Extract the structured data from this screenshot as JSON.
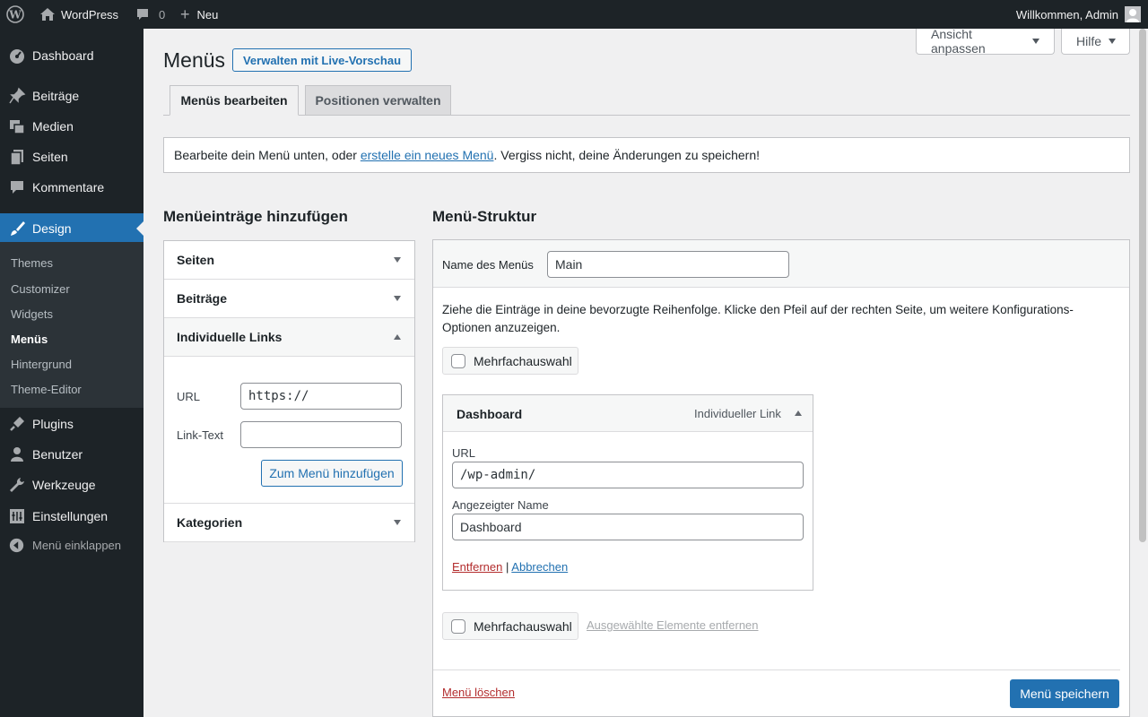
{
  "adminbar": {
    "site_name": "WordPress",
    "comments_count": "0",
    "new_label": "Neu",
    "greeting": "Willkommen, Admin"
  },
  "sidebar": {
    "items": [
      {
        "label": "Dashboard",
        "icon": "dashboard-icon"
      },
      {
        "label": "Beiträge",
        "icon": "pin-icon"
      },
      {
        "label": "Medien",
        "icon": "media-icon"
      },
      {
        "label": "Seiten",
        "icon": "pages-icon"
      },
      {
        "label": "Kommentare",
        "icon": "comment-icon"
      },
      {
        "label": "Design",
        "icon": "brush-icon"
      }
    ],
    "submenu": [
      "Themes",
      "Customizer",
      "Widgets",
      "Menüs",
      "Hintergrund",
      "Theme-Editor"
    ],
    "items2": [
      {
        "label": "Plugins",
        "icon": "plug-icon"
      },
      {
        "label": "Benutzer",
        "icon": "user-icon"
      },
      {
        "label": "Werkzeuge",
        "icon": "wrench-icon"
      },
      {
        "label": "Einstellungen",
        "icon": "settings-icon"
      }
    ],
    "collapse_label": "Menü einklappen"
  },
  "screen_options": {
    "view_label": "Ansicht anpassen",
    "help_label": "Hilfe"
  },
  "header": {
    "title": "Menüs",
    "live_preview_label": "Verwalten mit Live-Vorschau"
  },
  "tabs": [
    {
      "label": "Menüs bearbeiten"
    },
    {
      "label": "Positionen verwalten"
    }
  ],
  "notice": {
    "before": "Bearbeite dein Menü unten, oder ",
    "link": "erstelle ein neues Menü",
    "after": ". Vergiss nicht, deine Änderungen zu speichern!"
  },
  "add_items": {
    "heading": "Menüeinträge hinzufügen",
    "sections": [
      "Seiten",
      "Beiträge",
      "Individuelle Links",
      "Kategorien"
    ],
    "url_label": "URL",
    "url_value": "https://",
    "link_text_label": "Link-Text",
    "link_text_value": "",
    "add_button": "Zum Menü hinzufügen"
  },
  "structure": {
    "heading": "Menü-Struktur",
    "menu_name_label": "Name des Menüs",
    "menu_name_value": "Main",
    "instructions": "Ziehe die Einträge in deine bevorzugte Reihenfolge. Klicke den Pfeil auf der rechten Seite, um weitere Konfigurations-Optionen anzuzeigen.",
    "bulk_label": "Mehrfachauswahl",
    "item": {
      "title": "Dashboard",
      "type": "Individueller Link",
      "url_label": "URL",
      "url_value": "/wp-admin/",
      "nav_label": "Angezeigter Name",
      "nav_value": "Dashboard",
      "remove": "Entfernen",
      "separator": "|",
      "cancel": "Abbrechen"
    },
    "remove_selected": "Ausgewählte Elemente entfernen",
    "delete_menu": "Menü löschen",
    "save_menu": "Menü speichern"
  }
}
